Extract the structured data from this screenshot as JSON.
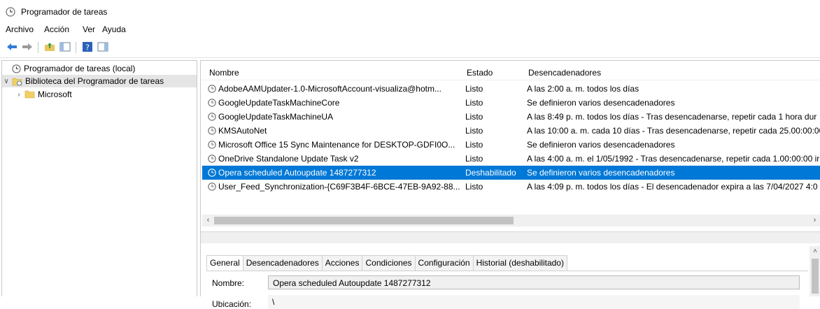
{
  "window": {
    "title": "Programador de tareas"
  },
  "menu": [
    "Archivo",
    "Acción",
    "Ver",
    "Ayuda"
  ],
  "toolbar": [
    "back-icon",
    "forward-icon",
    "up-folder-icon",
    "show-hide-tree-icon",
    "help-icon",
    "show-hide-action-pane-icon"
  ],
  "tree": {
    "root": "Programador de tareas (local)",
    "library": "Biblioteca del Programador de tareas",
    "child": "Microsoft"
  },
  "list": {
    "headers": {
      "name": "Nombre",
      "state": "Estado",
      "triggers": "Desencadenadores"
    },
    "rows": [
      {
        "name": "AdobeAAMUpdater-1.0-MicrosoftAccount-visualiza@hotm...",
        "state": "Listo",
        "triggers": "A las 2:00 a. m. todos los días"
      },
      {
        "name": "GoogleUpdateTaskMachineCore",
        "state": "Listo",
        "triggers": "Se definieron varios desencadenadores"
      },
      {
        "name": "GoogleUpdateTaskMachineUA",
        "state": "Listo",
        "triggers": "A las 8:49 p. m. todos los días - Tras desencadenarse, repetir cada 1 hora dur"
      },
      {
        "name": "KMSAutoNet",
        "state": "Listo",
        "triggers": "A las 10:00 a. m. cada 10 días - Tras desencadenarse, repetir cada 25.00:00:00"
      },
      {
        "name": "Microsoft Office 15 Sync Maintenance for DESKTOP-GDFI0O...",
        "state": "Listo",
        "triggers": "Se definieron varios desencadenadores"
      },
      {
        "name": "OneDrive Standalone Update Task v2",
        "state": "Listo",
        "triggers": "A las 4:00 a. m. el 1/05/1992 - Tras desencadenarse, repetir cada 1.00:00:00 ir"
      },
      {
        "name": "Opera scheduled Autoupdate 1487277312",
        "state": "Deshabilitado",
        "triggers": "Se definieron varios desencadenadores"
      },
      {
        "name": "User_Feed_Synchronization-{C69F3B4F-6BCE-47EB-9A92-88...",
        "state": "Listo",
        "triggers": "A las 4:09 p. m. todos los días - El desencadenador expira a las 7/04/2027 4:0"
      }
    ],
    "selected_index": 6
  },
  "details": {
    "tabs": [
      "General",
      "Desencadenadores",
      "Acciones",
      "Condiciones",
      "Configuración",
      "Historial (deshabilitado)"
    ],
    "active_tab": "General",
    "name_label": "Nombre:",
    "name_value": "Opera scheduled Autoupdate 1487277312",
    "location_label": "Ubicación:",
    "location_value": "\\"
  },
  "colors": {
    "selection": "#0078d7",
    "corner_accent": "#f5c892"
  }
}
